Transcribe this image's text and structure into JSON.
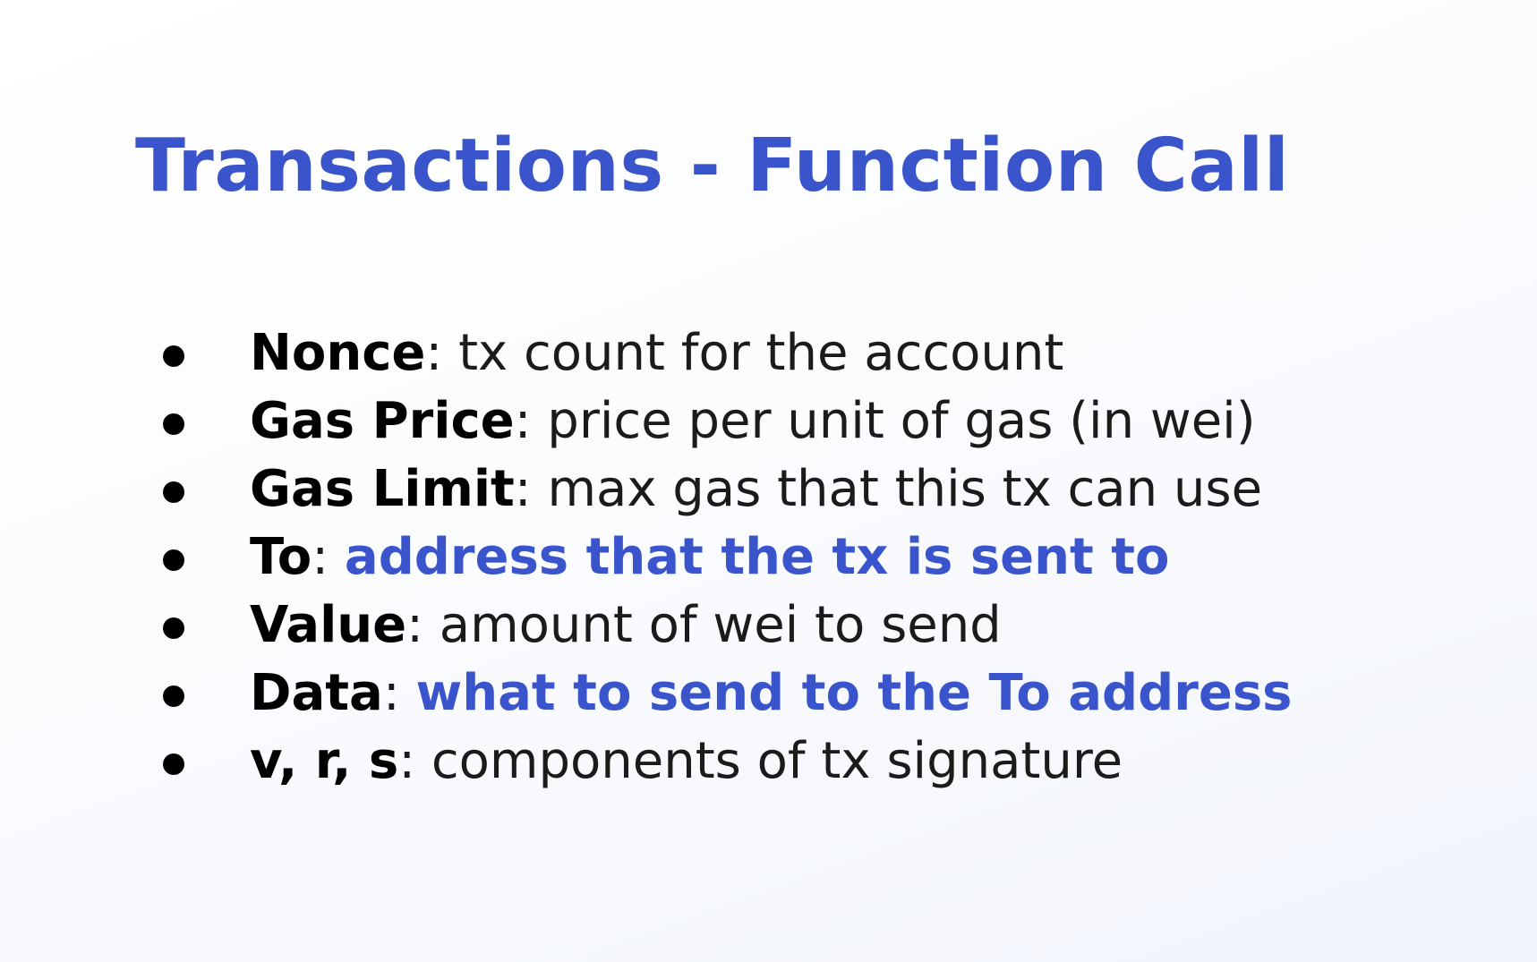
{
  "title": "Transactions - Function Call",
  "accent_color": "#3a55cc",
  "fields": [
    {
      "term": "Nonce",
      "separator": ": ",
      "description": "tx count for the account",
      "highlight": false
    },
    {
      "term": "Gas Price",
      "separator": ": ",
      "description": "price per unit of gas (in wei)",
      "highlight": false
    },
    {
      "term": "Gas Limit",
      "separator": ": ",
      "description": "max gas that this tx can use",
      "highlight": false
    },
    {
      "term": "To",
      "separator": ": ",
      "description": "address that the tx is sent to",
      "highlight": true
    },
    {
      "term": "Value",
      "separator": ": ",
      "description": "amount of wei to send",
      "highlight": false
    },
    {
      "term": "Data",
      "separator": ": ",
      "description": "what to send to the To address",
      "highlight": true
    },
    {
      "term": "v, r, s",
      "separator": ": ",
      "description": "components of tx signature",
      "highlight": false
    }
  ]
}
